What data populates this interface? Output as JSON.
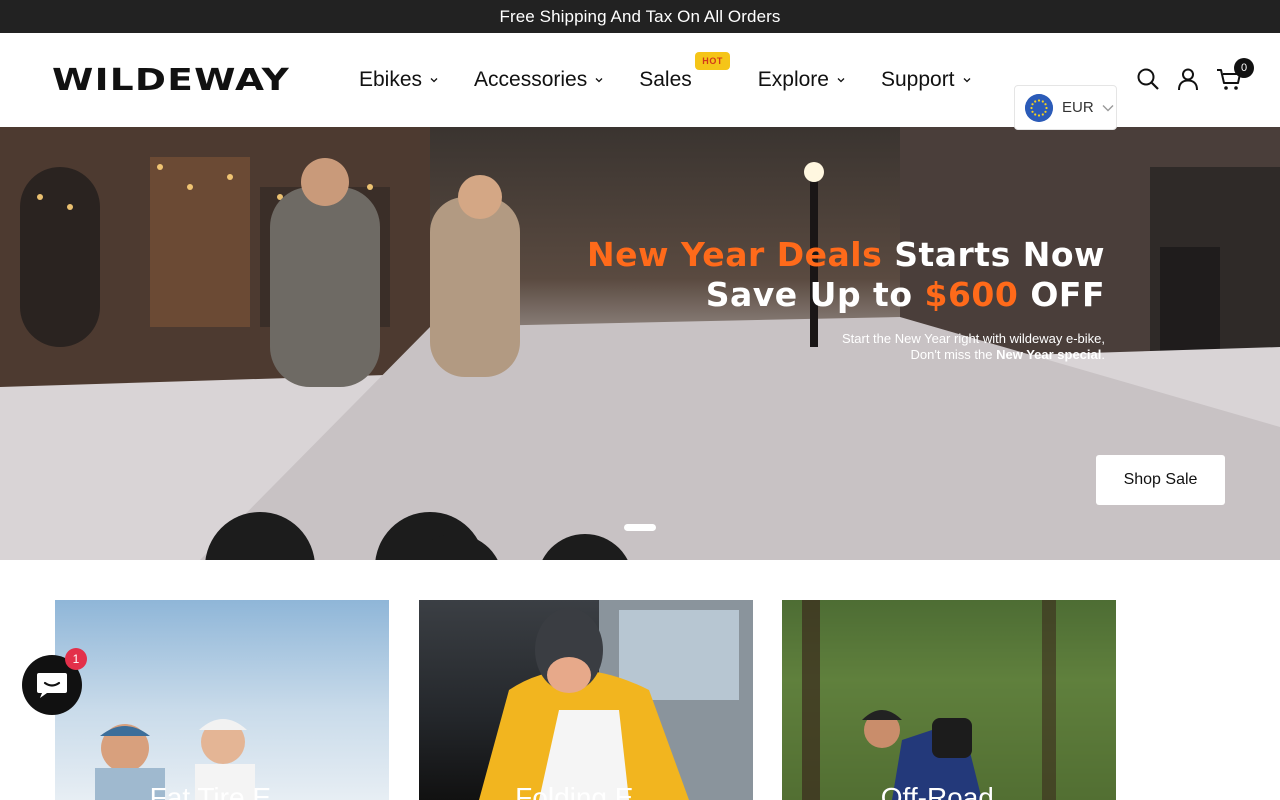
{
  "announcement": {
    "text": "Free Shipping And Tax On All Orders"
  },
  "brand": {
    "logo_text": "WILDEWAY"
  },
  "nav": {
    "items": [
      {
        "label": "Ebikes",
        "has_dropdown": true
      },
      {
        "label": "Accessories",
        "has_dropdown": true
      },
      {
        "label": "Sales",
        "has_dropdown": false,
        "badge": "HOT"
      },
      {
        "label": "Explore",
        "has_dropdown": true
      },
      {
        "label": "Support",
        "has_dropdown": true
      }
    ]
  },
  "header_icons": {
    "search": "search-icon",
    "account": "user-icon",
    "cart": "cart-icon",
    "cart_count": "0"
  },
  "currency": {
    "label": "EUR",
    "flag": "eu-flag-icon"
  },
  "hero": {
    "line1_highlight": "New Year Deals",
    "line1_rest": " Starts Now",
    "line2_prefix": "Save Up to ",
    "line2_highlight": "$600",
    "line2_suffix": " OFF",
    "sub_line1": "Start the New Year right with wildeway e-bike,",
    "sub_line2_prefix": "Don't miss the ",
    "sub_line2_bold": "New Year special",
    "sub_line2_suffix": ".",
    "cta": "Shop Sale"
  },
  "categories": [
    {
      "title": "Fat Tire E..."
    },
    {
      "title": "Folding E..."
    },
    {
      "title": "Off-Road..."
    }
  ],
  "chat": {
    "badge_count": "1"
  },
  "colors": {
    "accent_orange": "#ff6a1a",
    "hot_badge_bg": "#f5c518",
    "announcement_bg": "#222222"
  }
}
